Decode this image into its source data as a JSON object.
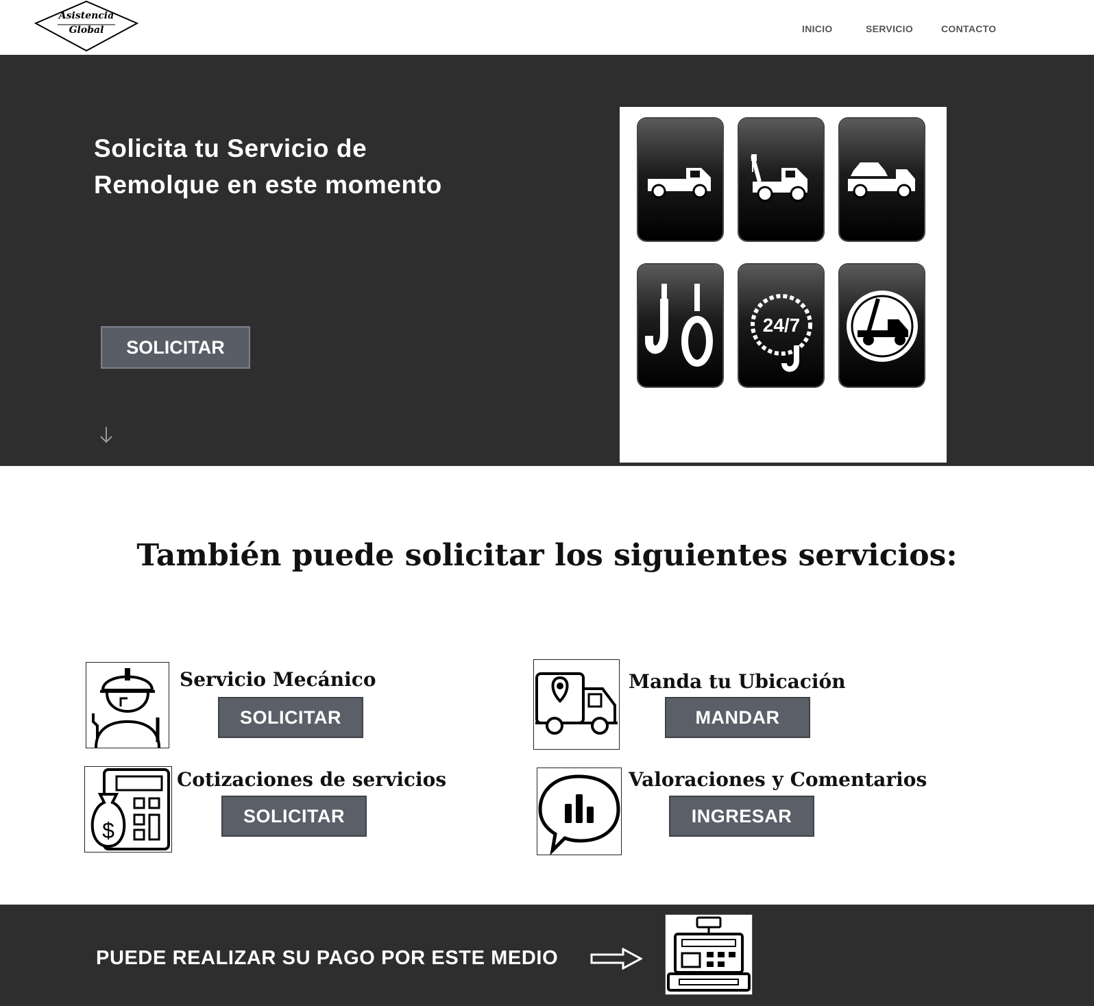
{
  "brand": {
    "logo_text_line1": "Asistencia",
    "logo_text_line2": "Global"
  },
  "nav": {
    "items": [
      {
        "label": "INICIO"
      },
      {
        "label": "SERVICIO"
      },
      {
        "label": "CONTACTO"
      }
    ]
  },
  "hero": {
    "title_line1": "Solicita tu Servicio de",
    "title_line2": "Remolque en este momento",
    "button_label": "SOLICITAR",
    "image_icons": [
      "flatbed-truck-icon",
      "tow-crane-truck-icon",
      "car-carrier-icon",
      "tow-hooks-icon",
      "chain-24-7-icon",
      "tow-truck-circle-icon"
    ],
    "image_badge": "24/7"
  },
  "services": {
    "title": "También puede solicitar los siguientes servicios:",
    "items": [
      {
        "label": "Servicio Mecánico",
        "button": "SOLICITAR",
        "icon": "mechanic-icon"
      },
      {
        "label": "Manda tu Ubicación",
        "button": "MANDAR",
        "icon": "location-truck-icon"
      },
      {
        "label": "Cotizaciones de servicios",
        "button": "SOLICITAR",
        "icon": "calculator-money-icon"
      },
      {
        "label": "Valoraciones y Comentarios",
        "button": "INGRESAR",
        "icon": "chat-chart-icon"
      }
    ]
  },
  "footer": {
    "payment_text": "PUEDE REALIZAR SU PAGO POR ESTE MEDIO",
    "payment_icon": "cash-register-icon"
  },
  "colors": {
    "dark_bg": "#2e2e2e",
    "button_bg": "#5b5f67",
    "text_light": "#ffffff",
    "text_dark": "#111111"
  }
}
